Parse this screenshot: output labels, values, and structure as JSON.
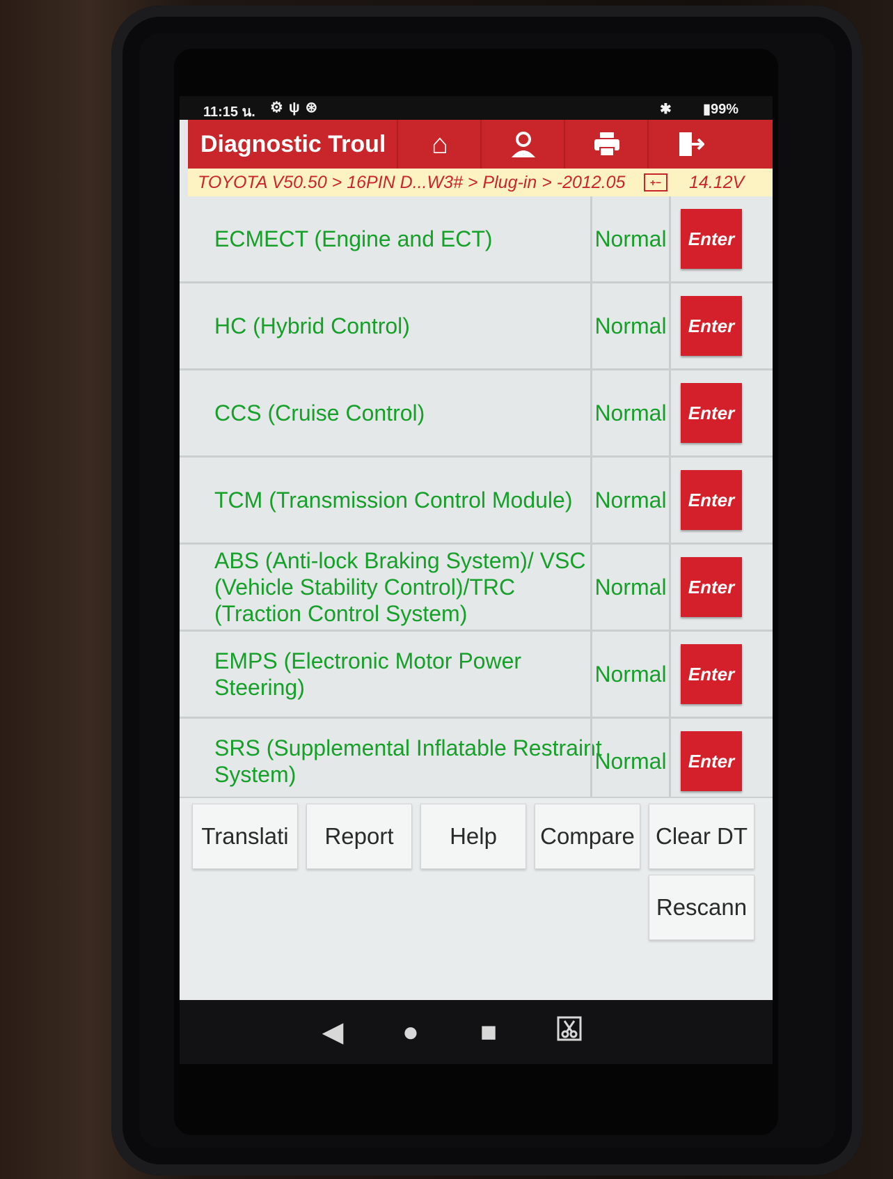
{
  "status_bar": {
    "time": "11:15 น.",
    "battery": "99%"
  },
  "app": {
    "title": "Diagnostic Troul",
    "breadcrumb": "TOYOTA V50.50 > 16PIN D...W3# > Plug-in > -2012.05",
    "voltage": "14.12V"
  },
  "systems": [
    {
      "name": "ECMECT (Engine and ECT)",
      "status": "Normal",
      "action": "Enter"
    },
    {
      "name": "HC (Hybrid Control)",
      "status": "Normal",
      "action": "Enter"
    },
    {
      "name": "CCS (Cruise Control)",
      "status": "Normal",
      "action": "Enter"
    },
    {
      "name": "TCM (Transmission Control Module)",
      "status": "Normal",
      "action": "Enter"
    },
    {
      "name": "ABS (Anti-lock Braking System)/ VSC (Vehicle Stability Control)/TRC (Traction Control System)",
      "status": "Normal",
      "action": "Enter"
    },
    {
      "name": "EMPS (Electronic Motor Power Steering)",
      "status": "Normal",
      "action": "Enter"
    },
    {
      "name": "SRS (Supplemental Inflatable Restraint System)",
      "status": "Normal",
      "action": "Enter"
    }
  ],
  "toolbar": {
    "translate": "Translati",
    "report": "Report",
    "help": "Help",
    "compare": "Compare",
    "clear_dtc": "Clear DT",
    "rescan": "Rescann"
  },
  "colors": {
    "header_red": "#c8262a",
    "status_green": "#16a02a",
    "breadcrumb_bg": "#fdf3c2"
  }
}
